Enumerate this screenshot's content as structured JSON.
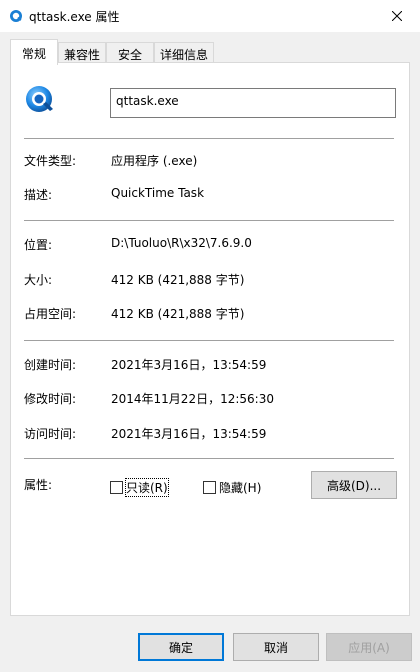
{
  "window": {
    "title": "qttask.exe 属性",
    "close_icon": "close-icon",
    "title_icon": "quicktime-icon"
  },
  "tabs": [
    {
      "label": "常规",
      "active": true
    },
    {
      "label": "兼容性",
      "active": false
    },
    {
      "label": "安全",
      "active": false
    },
    {
      "label": "详细信息",
      "active": false
    }
  ],
  "file": {
    "name": "qttask.exe",
    "icon": "quicktime-icon"
  },
  "type_section": {
    "type_label": "文件类型:",
    "type_value": "应用程序 (.exe)",
    "desc_label": "描述:",
    "desc_value": "QuickTime Task"
  },
  "location_section": {
    "location_label": "位置:",
    "location_value": "D:\\Tuoluo\\R\\x32\\7.6.9.0",
    "size_label": "大小:",
    "size_value": "412 KB (421,888 字节)",
    "disk_label": "占用空间:",
    "disk_value": "412 KB (421,888 字节)"
  },
  "time_section": {
    "created_label": "创建时间:",
    "created_value": "2021年3月16日，13:54:59",
    "modified_label": "修改时间:",
    "modified_value": "2014年11月22日，12:56:30",
    "accessed_label": "访问时间:",
    "accessed_value": "2021年3月16日，13:54:59"
  },
  "attributes": {
    "label": "属性:",
    "readonly_label": "只读(R)",
    "readonly_checked": false,
    "hidden_label": "隐藏(H)",
    "hidden_checked": false,
    "advanced_label": "高级(D)..."
  },
  "buttons": {
    "ok": "确定",
    "cancel": "取消",
    "apply": "应用(A)"
  },
  "colors": {
    "accent": "#0078d7",
    "panel_bg": "#ffffff",
    "window_bg": "#f0f0f0"
  }
}
